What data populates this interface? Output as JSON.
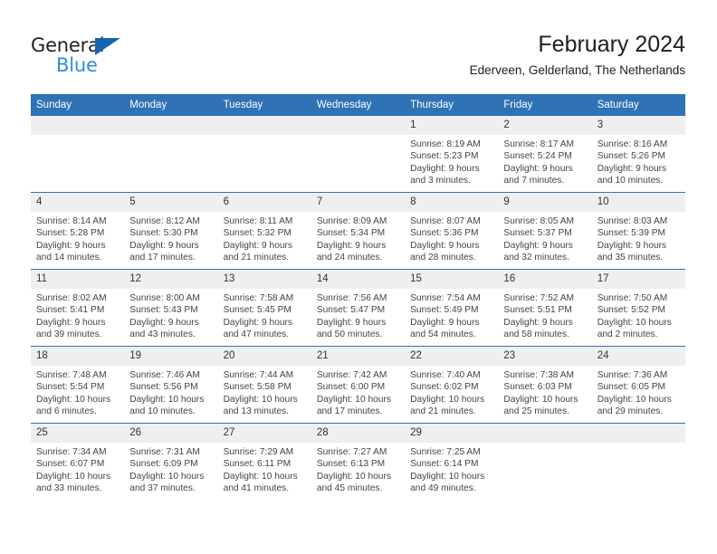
{
  "brand": {
    "name_top": "General",
    "name_bottom": "Blue"
  },
  "header": {
    "title": "February 2024",
    "subtitle": "Ederveen, Gelderland, The Netherlands"
  },
  "colors": {
    "header_blue": "#2f72b5",
    "logo_blue": "#2f8ddb",
    "daynum_bg": "#efeff0"
  },
  "weekdays": [
    "Sunday",
    "Monday",
    "Tuesday",
    "Wednesday",
    "Thursday",
    "Friday",
    "Saturday"
  ],
  "weeks": [
    [
      {
        "day": "",
        "sunrise": "",
        "sunset": "",
        "daylight_a": "",
        "daylight_b": ""
      },
      {
        "day": "",
        "sunrise": "",
        "sunset": "",
        "daylight_a": "",
        "daylight_b": ""
      },
      {
        "day": "",
        "sunrise": "",
        "sunset": "",
        "daylight_a": "",
        "daylight_b": ""
      },
      {
        "day": "",
        "sunrise": "",
        "sunset": "",
        "daylight_a": "",
        "daylight_b": ""
      },
      {
        "day": "1",
        "sunrise": "Sunrise: 8:19 AM",
        "sunset": "Sunset: 5:23 PM",
        "daylight_a": "Daylight: 9 hours",
        "daylight_b": "and 3 minutes."
      },
      {
        "day": "2",
        "sunrise": "Sunrise: 8:17 AM",
        "sunset": "Sunset: 5:24 PM",
        "daylight_a": "Daylight: 9 hours",
        "daylight_b": "and 7 minutes."
      },
      {
        "day": "3",
        "sunrise": "Sunrise: 8:16 AM",
        "sunset": "Sunset: 5:26 PM",
        "daylight_a": "Daylight: 9 hours",
        "daylight_b": "and 10 minutes."
      }
    ],
    [
      {
        "day": "4",
        "sunrise": "Sunrise: 8:14 AM",
        "sunset": "Sunset: 5:28 PM",
        "daylight_a": "Daylight: 9 hours",
        "daylight_b": "and 14 minutes."
      },
      {
        "day": "5",
        "sunrise": "Sunrise: 8:12 AM",
        "sunset": "Sunset: 5:30 PM",
        "daylight_a": "Daylight: 9 hours",
        "daylight_b": "and 17 minutes."
      },
      {
        "day": "6",
        "sunrise": "Sunrise: 8:11 AM",
        "sunset": "Sunset: 5:32 PM",
        "daylight_a": "Daylight: 9 hours",
        "daylight_b": "and 21 minutes."
      },
      {
        "day": "7",
        "sunrise": "Sunrise: 8:09 AM",
        "sunset": "Sunset: 5:34 PM",
        "daylight_a": "Daylight: 9 hours",
        "daylight_b": "and 24 minutes."
      },
      {
        "day": "8",
        "sunrise": "Sunrise: 8:07 AM",
        "sunset": "Sunset: 5:36 PM",
        "daylight_a": "Daylight: 9 hours",
        "daylight_b": "and 28 minutes."
      },
      {
        "day": "9",
        "sunrise": "Sunrise: 8:05 AM",
        "sunset": "Sunset: 5:37 PM",
        "daylight_a": "Daylight: 9 hours",
        "daylight_b": "and 32 minutes."
      },
      {
        "day": "10",
        "sunrise": "Sunrise: 8:03 AM",
        "sunset": "Sunset: 5:39 PM",
        "daylight_a": "Daylight: 9 hours",
        "daylight_b": "and 35 minutes."
      }
    ],
    [
      {
        "day": "11",
        "sunrise": "Sunrise: 8:02 AM",
        "sunset": "Sunset: 5:41 PM",
        "daylight_a": "Daylight: 9 hours",
        "daylight_b": "and 39 minutes."
      },
      {
        "day": "12",
        "sunrise": "Sunrise: 8:00 AM",
        "sunset": "Sunset: 5:43 PM",
        "daylight_a": "Daylight: 9 hours",
        "daylight_b": "and 43 minutes."
      },
      {
        "day": "13",
        "sunrise": "Sunrise: 7:58 AM",
        "sunset": "Sunset: 5:45 PM",
        "daylight_a": "Daylight: 9 hours",
        "daylight_b": "and 47 minutes."
      },
      {
        "day": "14",
        "sunrise": "Sunrise: 7:56 AM",
        "sunset": "Sunset: 5:47 PM",
        "daylight_a": "Daylight: 9 hours",
        "daylight_b": "and 50 minutes."
      },
      {
        "day": "15",
        "sunrise": "Sunrise: 7:54 AM",
        "sunset": "Sunset: 5:49 PM",
        "daylight_a": "Daylight: 9 hours",
        "daylight_b": "and 54 minutes."
      },
      {
        "day": "16",
        "sunrise": "Sunrise: 7:52 AM",
        "sunset": "Sunset: 5:51 PM",
        "daylight_a": "Daylight: 9 hours",
        "daylight_b": "and 58 minutes."
      },
      {
        "day": "17",
        "sunrise": "Sunrise: 7:50 AM",
        "sunset": "Sunset: 5:52 PM",
        "daylight_a": "Daylight: 10 hours",
        "daylight_b": "and 2 minutes."
      }
    ],
    [
      {
        "day": "18",
        "sunrise": "Sunrise: 7:48 AM",
        "sunset": "Sunset: 5:54 PM",
        "daylight_a": "Daylight: 10 hours",
        "daylight_b": "and 6 minutes."
      },
      {
        "day": "19",
        "sunrise": "Sunrise: 7:46 AM",
        "sunset": "Sunset: 5:56 PM",
        "daylight_a": "Daylight: 10 hours",
        "daylight_b": "and 10 minutes."
      },
      {
        "day": "20",
        "sunrise": "Sunrise: 7:44 AM",
        "sunset": "Sunset: 5:58 PM",
        "daylight_a": "Daylight: 10 hours",
        "daylight_b": "and 13 minutes."
      },
      {
        "day": "21",
        "sunrise": "Sunrise: 7:42 AM",
        "sunset": "Sunset: 6:00 PM",
        "daylight_a": "Daylight: 10 hours",
        "daylight_b": "and 17 minutes."
      },
      {
        "day": "22",
        "sunrise": "Sunrise: 7:40 AM",
        "sunset": "Sunset: 6:02 PM",
        "daylight_a": "Daylight: 10 hours",
        "daylight_b": "and 21 minutes."
      },
      {
        "day": "23",
        "sunrise": "Sunrise: 7:38 AM",
        "sunset": "Sunset: 6:03 PM",
        "daylight_a": "Daylight: 10 hours",
        "daylight_b": "and 25 minutes."
      },
      {
        "day": "24",
        "sunrise": "Sunrise: 7:36 AM",
        "sunset": "Sunset: 6:05 PM",
        "daylight_a": "Daylight: 10 hours",
        "daylight_b": "and 29 minutes."
      }
    ],
    [
      {
        "day": "25",
        "sunrise": "Sunrise: 7:34 AM",
        "sunset": "Sunset: 6:07 PM",
        "daylight_a": "Daylight: 10 hours",
        "daylight_b": "and 33 minutes."
      },
      {
        "day": "26",
        "sunrise": "Sunrise: 7:31 AM",
        "sunset": "Sunset: 6:09 PM",
        "daylight_a": "Daylight: 10 hours",
        "daylight_b": "and 37 minutes."
      },
      {
        "day": "27",
        "sunrise": "Sunrise: 7:29 AM",
        "sunset": "Sunset: 6:11 PM",
        "daylight_a": "Daylight: 10 hours",
        "daylight_b": "and 41 minutes."
      },
      {
        "day": "28",
        "sunrise": "Sunrise: 7:27 AM",
        "sunset": "Sunset: 6:13 PM",
        "daylight_a": "Daylight: 10 hours",
        "daylight_b": "and 45 minutes."
      },
      {
        "day": "29",
        "sunrise": "Sunrise: 7:25 AM",
        "sunset": "Sunset: 6:14 PM",
        "daylight_a": "Daylight: 10 hours",
        "daylight_b": "and 49 minutes."
      },
      {
        "day": "",
        "sunrise": "",
        "sunset": "",
        "daylight_a": "",
        "daylight_b": ""
      },
      {
        "day": "",
        "sunrise": "",
        "sunset": "",
        "daylight_a": "",
        "daylight_b": ""
      }
    ]
  ]
}
